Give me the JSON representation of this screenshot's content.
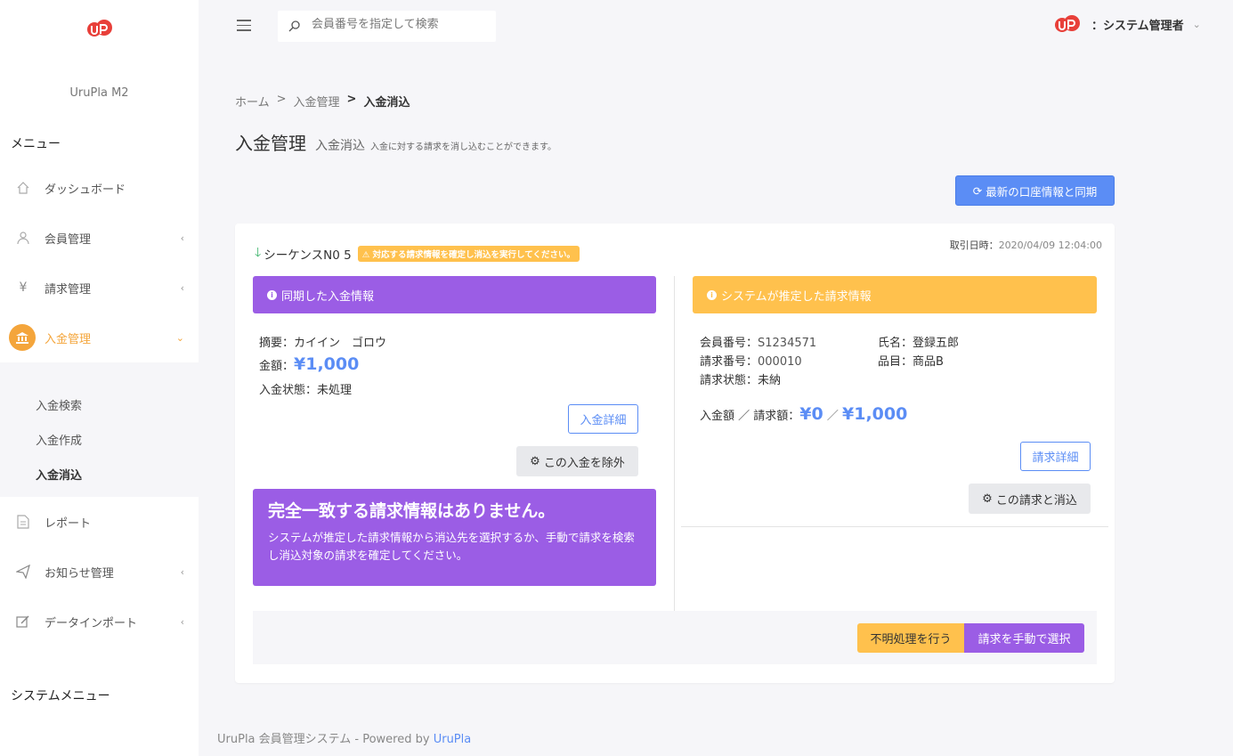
{
  "sidebar": {
    "brand": "UruPla M2",
    "menu_header": "メニュー",
    "items": [
      {
        "label": "ダッシュボード",
        "icon": "home-icon"
      },
      {
        "label": "会員管理",
        "icon": "user-icon"
      },
      {
        "label": "請求管理",
        "icon": "yen-icon"
      },
      {
        "label": "入金管理",
        "icon": "bank-icon"
      },
      {
        "label": "レポート",
        "icon": "document-icon"
      },
      {
        "label": "お知らせ管理",
        "icon": "send-icon"
      },
      {
        "label": "データインポート",
        "icon": "edit-icon"
      }
    ],
    "subitems": [
      {
        "label": "入金検索"
      },
      {
        "label": "入金作成"
      },
      {
        "label": "入金消込"
      }
    ],
    "system_menu_header": "システムメニュー"
  },
  "topbar": {
    "search_placeholder": "会員番号を指定して検索",
    "user_name": "：システム管理者"
  },
  "breadcrumb": {
    "home": "ホーム",
    "sep1": ">",
    "parent": "入金管理",
    "sep2": ">",
    "current": "入金消込"
  },
  "page": {
    "title": "入金管理",
    "subtitle": "入金消込",
    "description": "入金に対する請求を消し込むことができます。",
    "sync_button": "最新の口座情報と同期"
  },
  "card": {
    "sequence": "シーケンスN0 5",
    "warning": "対応する請求情報を確定し消込を実行してください。",
    "tx_date_label": "取引日時：",
    "tx_date_value": "2020/04/09 12:04:00",
    "left": {
      "header": "同期した入金情報",
      "summary_label": "摘要：",
      "summary_value": "カイイン　ゴロウ",
      "amount_label": "金額：",
      "amount_value": "¥1,000",
      "status_label": "入金状態：",
      "status_value": "未処理",
      "detail_button": "入金詳細",
      "exclude_button": "この入金を除外",
      "alert_title": "完全一致する請求情報はありません。",
      "alert_body": "システムが推定した請求情報から消込先を選択するか、手動で請求を検索し消込対象の請求を確定してください。"
    },
    "right": {
      "header": "システムが推定した請求情報",
      "member_no_label": "会員番号：",
      "member_no_value": "S1234571",
      "name_label": "氏名：",
      "name_value": "登録五郎",
      "invoice_no_label": "請求番号：",
      "invoice_no_value": "000010",
      "item_label": "品目：",
      "item_value": "商品B",
      "invoice_status_label": "請求状態：",
      "invoice_status_value": "未納",
      "amounts_label": "入金額 ／ 請求額：",
      "paid_amount": "¥0",
      "amount_sep": "／",
      "billed_amount": "¥1,000",
      "detail_button": "請求詳細",
      "reconcile_button": "この請求と消込"
    },
    "footer": {
      "unknown_button": "不明処理を行う",
      "manual_button": "請求を手動で選択"
    }
  },
  "footer": {
    "text": "UruPla 会員管理システム - Powered by ",
    "link": "UruPla"
  },
  "colors": {
    "accent_orange": "#f4a53b",
    "purple": "#9b5de5",
    "yellow": "#ffc14d",
    "blue": "#5b8df5",
    "brand_red": "#e8403a"
  }
}
